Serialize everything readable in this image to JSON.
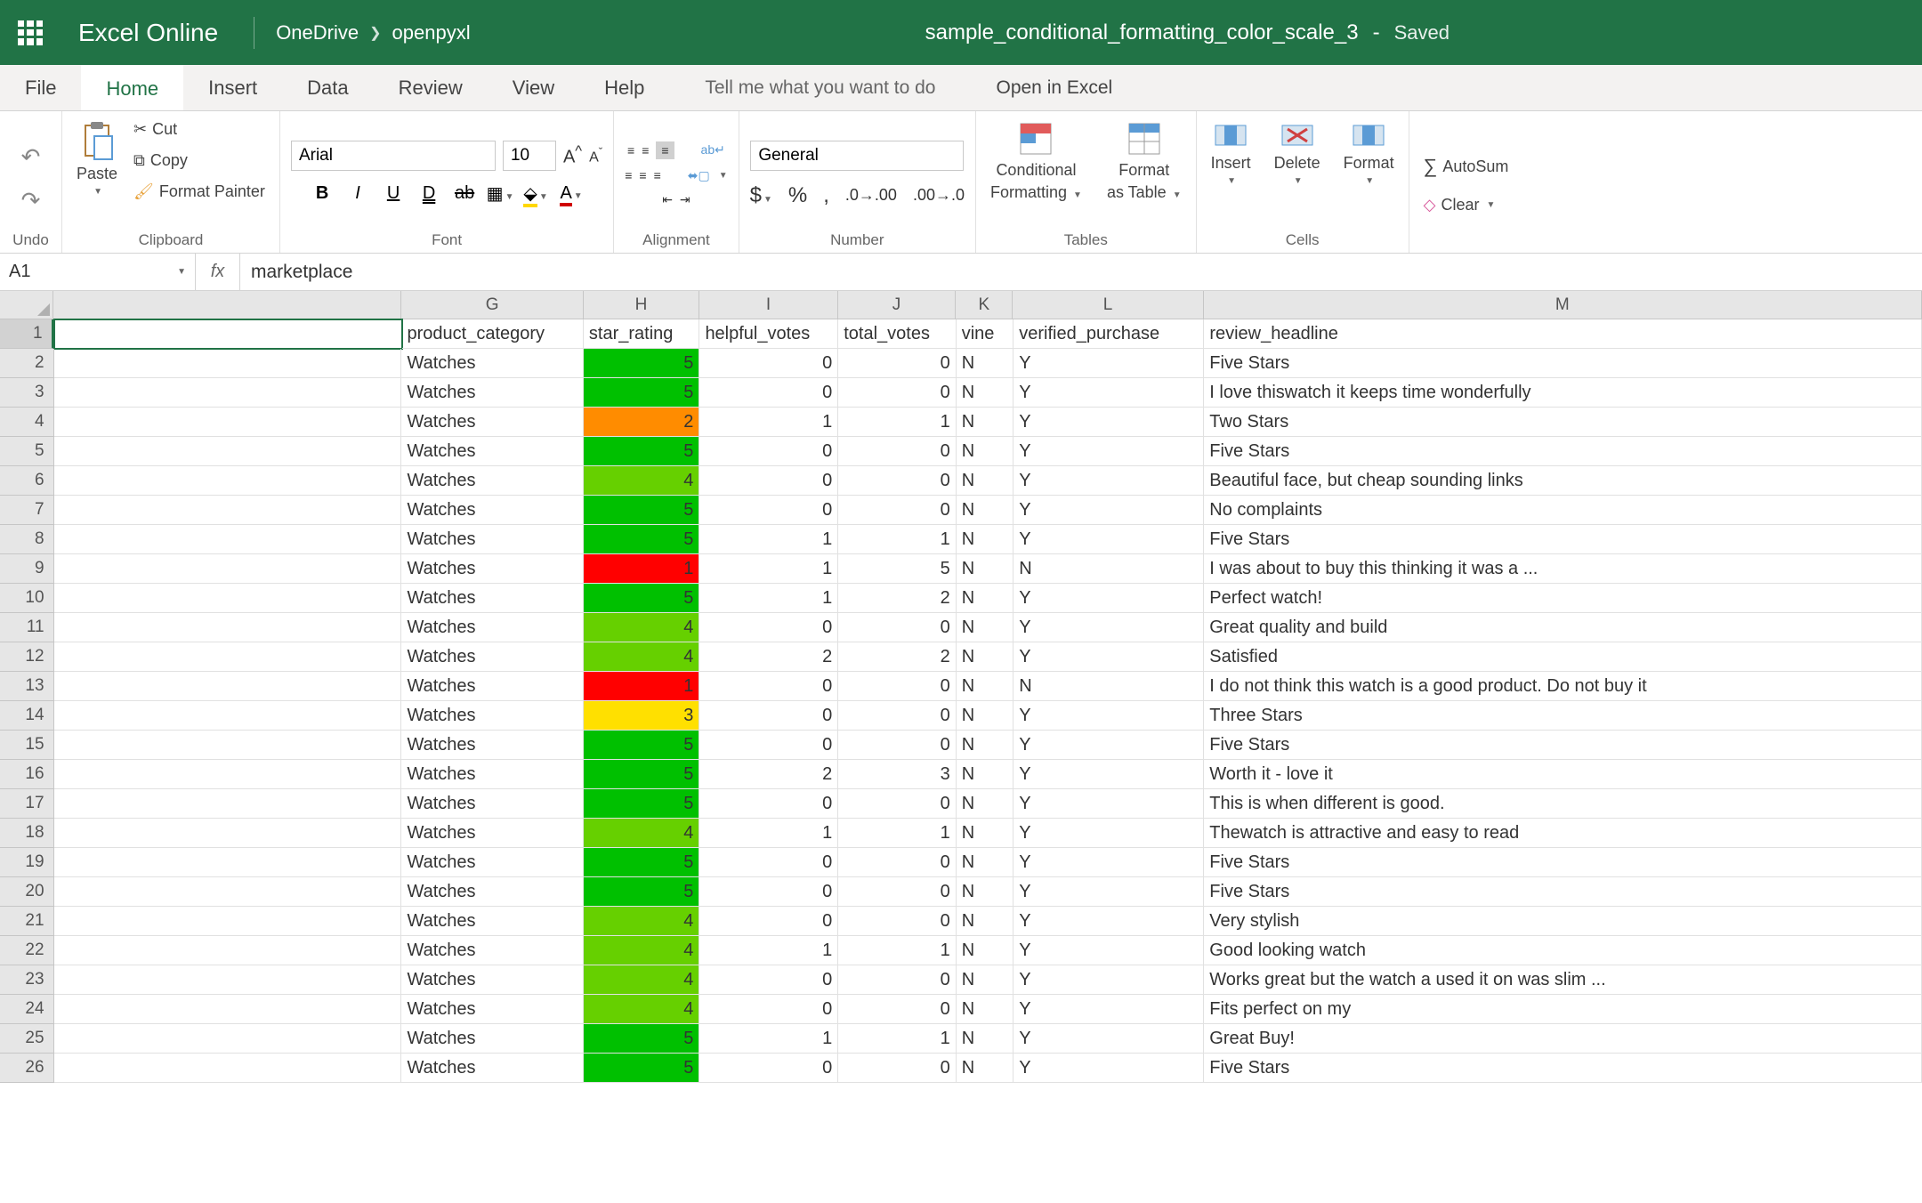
{
  "app": {
    "name": "Excel Online"
  },
  "breadcrumb": {
    "root": "OneDrive",
    "folder": "openpyxl"
  },
  "doc": {
    "title": "sample_conditional_formatting_color_scale_3",
    "status": "Saved"
  },
  "menus": {
    "file": "File",
    "home": "Home",
    "insert": "Insert",
    "data": "Data",
    "review": "Review",
    "view": "View",
    "help": "Help",
    "tell_me": "Tell me what you want to do",
    "open_in_excel": "Open in Excel"
  },
  "ribbon": {
    "undo_label": "Undo",
    "clipboard": {
      "paste": "Paste",
      "cut": "Cut",
      "copy": "Copy",
      "format_painter": "Format Painter",
      "label": "Clipboard"
    },
    "font": {
      "name": "Arial",
      "size": "10",
      "label": "Font"
    },
    "alignment": {
      "wrap": "Wrap",
      "label": "Alignment"
    },
    "number": {
      "format": "General",
      "label": "Number"
    },
    "tables": {
      "cond": "Conditional",
      "cond2": "Formatting",
      "fmt": "Format",
      "fmt2": "as Table",
      "label": "Tables"
    },
    "cells": {
      "insert": "Insert",
      "delete": "Delete",
      "format": "Format",
      "label": "Cells"
    },
    "editing": {
      "autosum": "AutoSum",
      "clear": "Clear"
    }
  },
  "name_box": "A1",
  "formula": "marketplace",
  "columns": [
    "G",
    "H",
    "I",
    "J",
    "K",
    "L",
    "M"
  ],
  "headers": {
    "G": "product_category",
    "H": "star_rating",
    "I": "helpful_votes",
    "J": "total_votes",
    "K": "vine",
    "L": "verified_purchase",
    "M": "review_headline"
  },
  "rows": [
    {
      "G": "Watches",
      "H": 5,
      "I": 0,
      "J": 0,
      "K": "N",
      "L": "Y",
      "M": "Five Stars",
      "color": "#00c000"
    },
    {
      "G": "Watches",
      "H": 5,
      "I": 0,
      "J": 0,
      "K": "N",
      "L": "Y",
      "M": "I love thiswatch it keeps time wonderfully",
      "color": "#00c000"
    },
    {
      "G": "Watches",
      "H": 2,
      "I": 1,
      "J": 1,
      "K": "N",
      "L": "Y",
      "M": "Two Stars",
      "color": "#ff8c00"
    },
    {
      "G": "Watches",
      "H": 5,
      "I": 0,
      "J": 0,
      "K": "N",
      "L": "Y",
      "M": "Five Stars",
      "color": "#00c000"
    },
    {
      "G": "Watches",
      "H": 4,
      "I": 0,
      "J": 0,
      "K": "N",
      "L": "Y",
      "M": "Beautiful face, but cheap sounding links",
      "color": "#66d000"
    },
    {
      "G": "Watches",
      "H": 5,
      "I": 0,
      "J": 0,
      "K": "N",
      "L": "Y",
      "M": "No complaints",
      "color": "#00c000"
    },
    {
      "G": "Watches",
      "H": 5,
      "I": 1,
      "J": 1,
      "K": "N",
      "L": "Y",
      "M": "Five Stars",
      "color": "#00c000"
    },
    {
      "G": "Watches",
      "H": 1,
      "I": 1,
      "J": 5,
      "K": "N",
      "L": "N",
      "M": "I was about to buy this thinking it was a ...",
      "color": "#ff0000"
    },
    {
      "G": "Watches",
      "H": 5,
      "I": 1,
      "J": 2,
      "K": "N",
      "L": "Y",
      "M": "Perfect watch!",
      "color": "#00c000"
    },
    {
      "G": "Watches",
      "H": 4,
      "I": 0,
      "J": 0,
      "K": "N",
      "L": "Y",
      "M": "Great quality and build",
      "color": "#66d000"
    },
    {
      "G": "Watches",
      "H": 4,
      "I": 2,
      "J": 2,
      "K": "N",
      "L": "Y",
      "M": "Satisfied",
      "color": "#66d000"
    },
    {
      "G": "Watches",
      "H": 1,
      "I": 0,
      "J": 0,
      "K": "N",
      "L": "N",
      "M": "I do not think this watch is a good product. Do not buy it",
      "color": "#ff0000"
    },
    {
      "G": "Watches",
      "H": 3,
      "I": 0,
      "J": 0,
      "K": "N",
      "L": "Y",
      "M": "Three Stars",
      "color": "#ffe000"
    },
    {
      "G": "Watches",
      "H": 5,
      "I": 0,
      "J": 0,
      "K": "N",
      "L": "Y",
      "M": "Five Stars",
      "color": "#00c000"
    },
    {
      "G": "Watches",
      "H": 5,
      "I": 2,
      "J": 3,
      "K": "N",
      "L": "Y",
      "M": "Worth it - love it",
      "color": "#00c000"
    },
    {
      "G": "Watches",
      "H": 5,
      "I": 0,
      "J": 0,
      "K": "N",
      "L": "Y",
      "M": "This is when different is good.",
      "color": "#00c000"
    },
    {
      "G": "Watches",
      "H": 4,
      "I": 1,
      "J": 1,
      "K": "N",
      "L": "Y",
      "M": "Thewatch is attractive and easy to read",
      "color": "#66d000"
    },
    {
      "G": "Watches",
      "H": 5,
      "I": 0,
      "J": 0,
      "K": "N",
      "L": "Y",
      "M": "Five Stars",
      "color": "#00c000"
    },
    {
      "G": "Watches",
      "H": 5,
      "I": 0,
      "J": 0,
      "K": "N",
      "L": "Y",
      "M": "Five Stars",
      "color": "#00c000"
    },
    {
      "G": "Watches",
      "H": 4,
      "I": 0,
      "J": 0,
      "K": "N",
      "L": "Y",
      "M": "Very stylish",
      "color": "#66d000"
    },
    {
      "G": "Watches",
      "H": 4,
      "I": 1,
      "J": 1,
      "K": "N",
      "L": "Y",
      "M": "Good looking watch",
      "color": "#66d000"
    },
    {
      "G": "Watches",
      "H": 4,
      "I": 0,
      "J": 0,
      "K": "N",
      "L": "Y",
      "M": "Works great but the watch a used it on was slim ...",
      "color": "#66d000"
    },
    {
      "G": "Watches",
      "H": 4,
      "I": 0,
      "J": 0,
      "K": "N",
      "L": "Y",
      "M": "Fits perfect on my",
      "color": "#66d000"
    },
    {
      "G": "Watches",
      "H": 5,
      "I": 1,
      "J": 1,
      "K": "N",
      "L": "Y",
      "M": "Great Buy!",
      "color": "#00c000"
    },
    {
      "G": "Watches",
      "H": 5,
      "I": 0,
      "J": 0,
      "K": "N",
      "L": "Y",
      "M": "Five Stars",
      "color": "#00c000"
    }
  ]
}
